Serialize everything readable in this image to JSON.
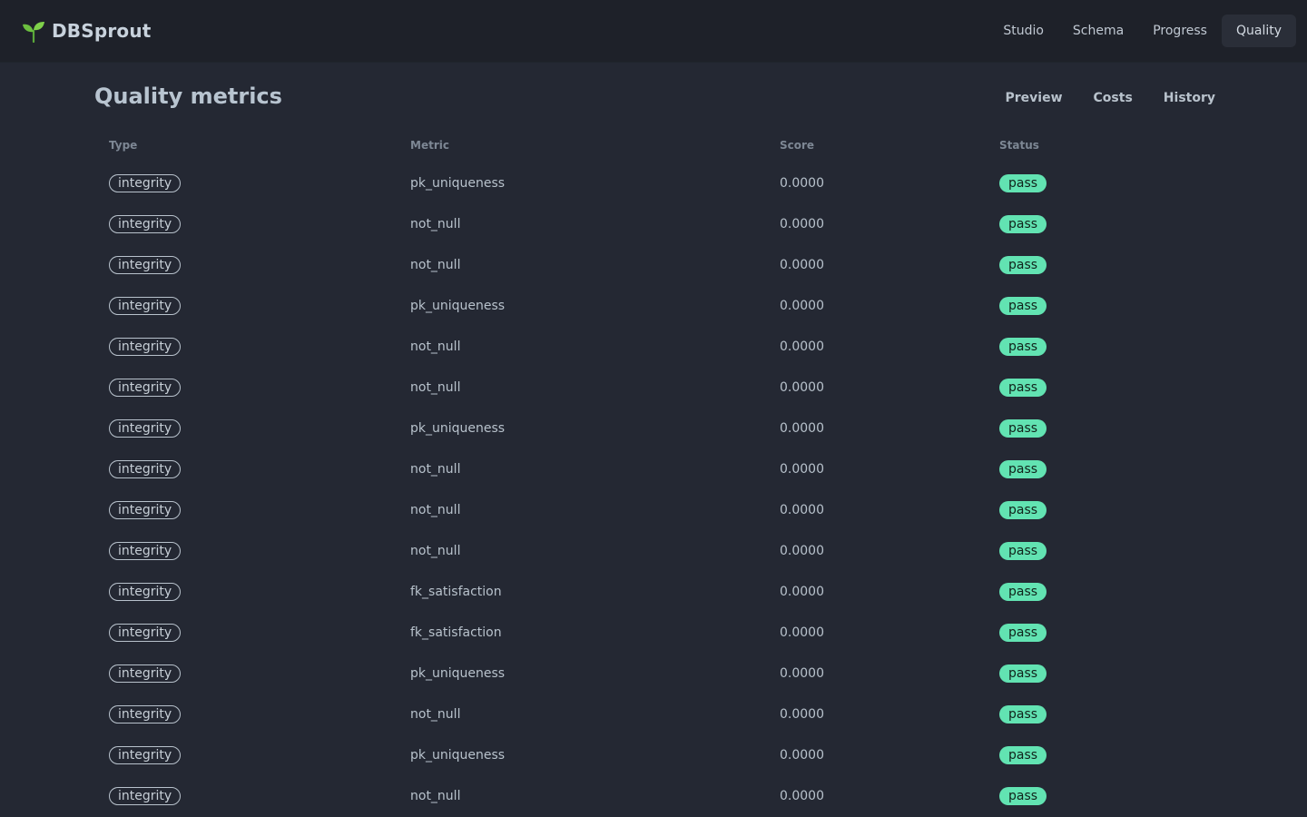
{
  "app": {
    "name": "DBSprout",
    "logo_icon": "sprout-icon",
    "accent_color": "#62e3b2"
  },
  "nav": [
    {
      "label": "Studio",
      "active": false
    },
    {
      "label": "Schema",
      "active": false
    },
    {
      "label": "Progress",
      "active": false
    },
    {
      "label": "Quality",
      "active": true
    }
  ],
  "page": {
    "title": "Quality metrics"
  },
  "subnav": [
    {
      "label": "Preview"
    },
    {
      "label": "Costs"
    },
    {
      "label": "History"
    }
  ],
  "table": {
    "headers": {
      "type": "Type",
      "metric": "Metric",
      "score": "Score",
      "status": "Status"
    },
    "rows": [
      {
        "type": "integrity",
        "metric": "pk_uniqueness",
        "score": "0.0000",
        "status": "pass"
      },
      {
        "type": "integrity",
        "metric": "not_null",
        "score": "0.0000",
        "status": "pass"
      },
      {
        "type": "integrity",
        "metric": "not_null",
        "score": "0.0000",
        "status": "pass"
      },
      {
        "type": "integrity",
        "metric": "pk_uniqueness",
        "score": "0.0000",
        "status": "pass"
      },
      {
        "type": "integrity",
        "metric": "not_null",
        "score": "0.0000",
        "status": "pass"
      },
      {
        "type": "integrity",
        "metric": "not_null",
        "score": "0.0000",
        "status": "pass"
      },
      {
        "type": "integrity",
        "metric": "pk_uniqueness",
        "score": "0.0000",
        "status": "pass"
      },
      {
        "type": "integrity",
        "metric": "not_null",
        "score": "0.0000",
        "status": "pass"
      },
      {
        "type": "integrity",
        "metric": "not_null",
        "score": "0.0000",
        "status": "pass"
      },
      {
        "type": "integrity",
        "metric": "not_null",
        "score": "0.0000",
        "status": "pass"
      },
      {
        "type": "integrity",
        "metric": "fk_satisfaction",
        "score": "0.0000",
        "status": "pass"
      },
      {
        "type": "integrity",
        "metric": "fk_satisfaction",
        "score": "0.0000",
        "status": "pass"
      },
      {
        "type": "integrity",
        "metric": "pk_uniqueness",
        "score": "0.0000",
        "status": "pass"
      },
      {
        "type": "integrity",
        "metric": "not_null",
        "score": "0.0000",
        "status": "pass"
      },
      {
        "type": "integrity",
        "metric": "pk_uniqueness",
        "score": "0.0000",
        "status": "pass"
      },
      {
        "type": "integrity",
        "metric": "not_null",
        "score": "0.0000",
        "status": "pass"
      }
    ]
  }
}
